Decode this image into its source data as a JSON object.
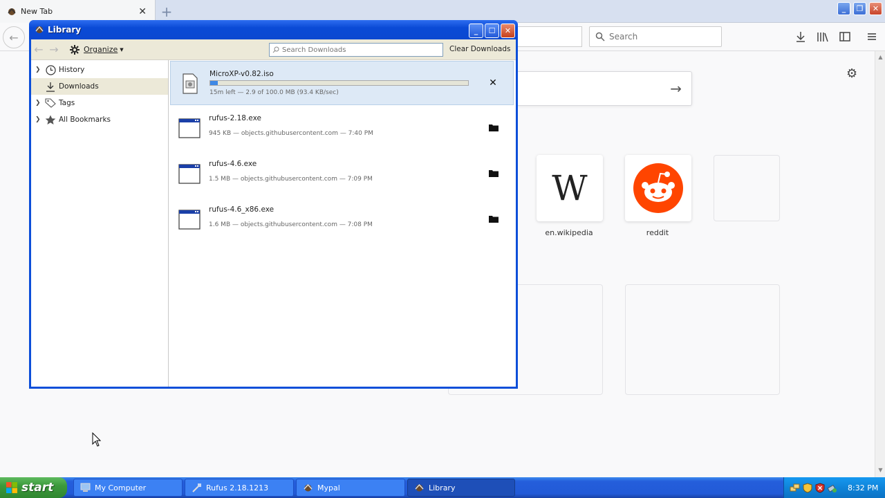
{
  "browser": {
    "tab_title": "New Tab",
    "tab_close": "✕",
    "new_tab": "+",
    "search_placeholder": "Search"
  },
  "newtab": {
    "tiles": [
      {
        "label": "en.wikipedia",
        "letter": "W"
      },
      {
        "label": "reddit"
      }
    ]
  },
  "library": {
    "title": "Library",
    "organize_label": "Organize",
    "search_placeholder": "Search Downloads",
    "clear_label": "Clear Downloads",
    "tree": [
      {
        "label": "History"
      },
      {
        "label": "Downloads"
      },
      {
        "label": "Tags"
      },
      {
        "label": "All Bookmarks"
      }
    ],
    "downloads": [
      {
        "name": "MicroXP-v0.82.iso",
        "status": "15m left — 2.9 of 100.0 MB (93.4 KB/sec)",
        "progress_pct": 2.9,
        "action": "✕"
      },
      {
        "name": "rufus-2.18.exe",
        "status": "945 KB — objects.githubusercontent.com — 7:40 PM"
      },
      {
        "name": "rufus-4.6.exe",
        "status": "1.5 MB — objects.githubusercontent.com — 7:09 PM"
      },
      {
        "name": "rufus-4.6_x86.exe",
        "status": "1.6 MB — objects.githubusercontent.com — 7:08 PM"
      }
    ]
  },
  "taskbar": {
    "start_label": "start",
    "tasks": [
      {
        "label": "My Computer"
      },
      {
        "label": "Rufus 2.18.1213"
      },
      {
        "label": "Mypal"
      },
      {
        "label": "Library"
      }
    ],
    "clock": "8:32 PM"
  }
}
